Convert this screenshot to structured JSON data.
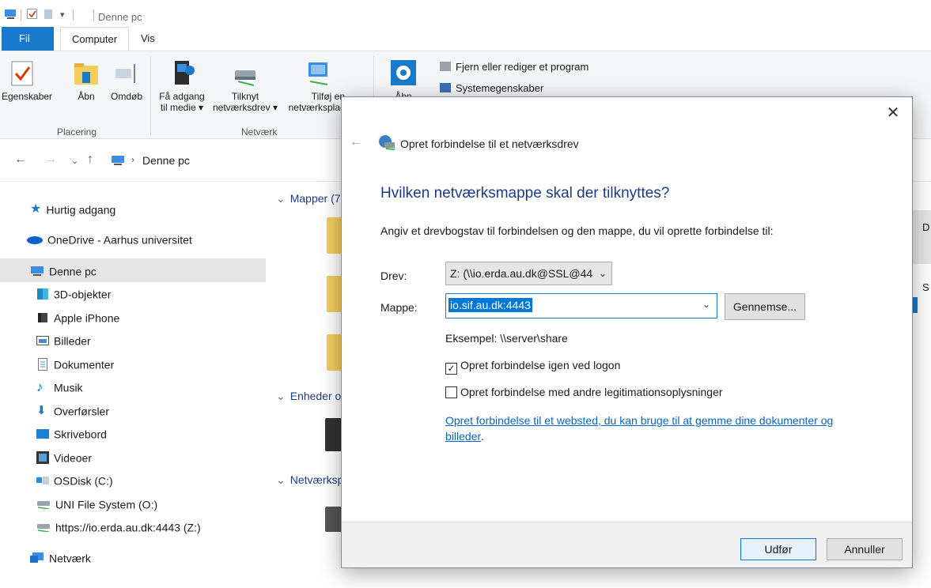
{
  "window": {
    "title": "Denne pc"
  },
  "ribbon": {
    "tabs": [
      "Fil",
      "Computer",
      "Vis"
    ],
    "buttons": {
      "properties": "Egenskaber",
      "open": "Åbn",
      "rename": "Omdøb",
      "media_1": "Få adgang",
      "media_2": "til medie ▾",
      "map_drive_1": "Tilknyt",
      "map_drive_2": "netværksdrev ▾",
      "add_location_1": "Tilføj en",
      "add_location_2": "netværksplac",
      "settings": "Åbn",
      "uninstall": "Fjern eller rediger et program",
      "system_properties": "Systemegenskaber"
    },
    "groups": {
      "location": "Placering",
      "network": "Netværk"
    }
  },
  "address": {
    "path": "Denne pc"
  },
  "nav": {
    "items": [
      {
        "label": "Hurtig adgang",
        "icon": "star-icon"
      },
      {
        "label": "OneDrive - Aarhus universitet",
        "icon": "cloud-icon"
      },
      {
        "label": "Denne pc",
        "icon": "computer-icon"
      },
      {
        "label": "3D-objekter",
        "icon": "cube-icon"
      },
      {
        "label": "Apple iPhone",
        "icon": "phone-icon"
      },
      {
        "label": "Billeder",
        "icon": "pictures-icon"
      },
      {
        "label": "Dokumenter",
        "icon": "document-icon"
      },
      {
        "label": "Musik",
        "icon": "music-icon"
      },
      {
        "label": "Overførsler",
        "icon": "download-icon"
      },
      {
        "label": "Skrivebord",
        "icon": "desktop-icon"
      },
      {
        "label": "Videoer",
        "icon": "video-icon"
      },
      {
        "label": "OSDisk (C:)",
        "icon": "os-drive-icon"
      },
      {
        "label": "UNI File System (O:)",
        "icon": "network-drive-icon"
      },
      {
        "label": "https://io.erda.au.dk:4443 (Z:)",
        "icon": "network-drive-icon"
      },
      {
        "label": "Netværk",
        "icon": "network-icon"
      }
    ]
  },
  "content": {
    "groups": [
      "Mapper (7",
      "Enheder o",
      "Netværksp"
    ],
    "edge_text_1": "D",
    "edge_text_2": "S"
  },
  "dialog": {
    "title": "Opret forbindelse til et netværksdrev",
    "heading": "Hvilken netværksmappe skal der tilknyttes?",
    "instruction": "Angiv et drevbogstav til forbindelsen og den mappe, du vil oprette forbindelse til:",
    "drive_label": "Drev:",
    "drive_value": "Z: (\\\\io.erda.au.dk@SSL@44",
    "folder_label": "Mappe:",
    "folder_value": "io.sif.au.dk:4443",
    "browse": "Gennemse...",
    "example": "Eksempel: \\\\server\\share",
    "reconnect_label": "Opret forbindelse igen ved logon",
    "reconnect_checked": true,
    "other_credentials_label": "Opret forbindelse med andre legitimationsoplysninger",
    "other_credentials_checked": false,
    "link_1": "Opret forbindelse til et websted, du kan bruge til at gemme dine dokumenter og",
    "link_2": "billeder",
    "link_end": ".",
    "finish": "Udfør",
    "cancel": "Annuller"
  },
  "colors": {
    "accent": "#1979ca",
    "heading": "#1b3a8c",
    "link": "#0066cc",
    "folder": "#f5cd5e"
  }
}
